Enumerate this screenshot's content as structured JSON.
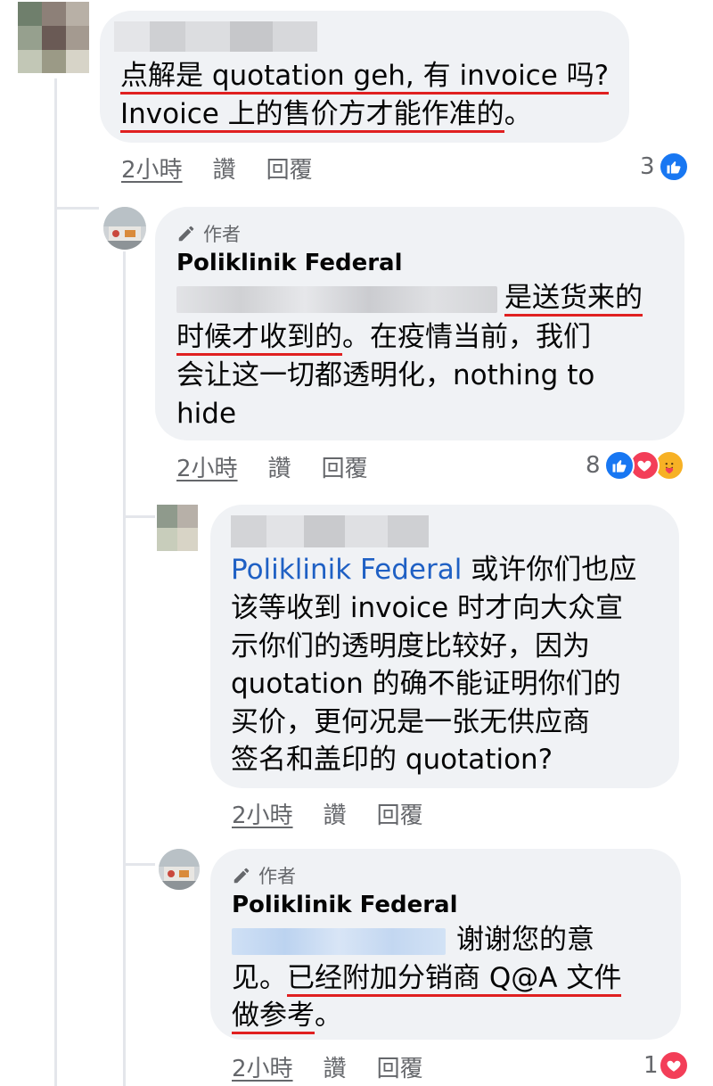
{
  "c1": {
    "text_l1a": "点解是 quotation geh, 有 invoice 吗?",
    "text_l2a": "Invoice 上的售价方才能作准的",
    "text_l2b": "。",
    "time": "2小時",
    "like": "讚",
    "reply": "回覆",
    "react_count": "3"
  },
  "c2": {
    "author_tag": "作者",
    "name": "Poliklinik Federal",
    "l1": "是送货来的",
    "l2a": "时候才收到的",
    "l2b": "。在疫情当前，我们",
    "l3": "会让这一切都透明化，nothing to",
    "l4": "hide",
    "time": "2小時",
    "like": "讚",
    "reply": "回覆",
    "react_count": "8"
  },
  "c3": {
    "mention": "Poliklinik Federal",
    "l1": " 或许你们也应",
    "l2": "该等收到 invoice 时才向大众宣",
    "l3": "示你们的透明度比较好，因为",
    "l4": "quotation 的确不能证明你们的",
    "l5": "买价，更何况是一张无供应商",
    "l6": "签名和盖印的 quotation?",
    "time": "2小時",
    "like": "讚",
    "reply": "回覆"
  },
  "c4": {
    "author_tag": "作者",
    "name": "Poliklinik Federal",
    "l1": "谢谢您的意",
    "l2a": "见。",
    "l2b": "已经附加分销商 Q@A 文件",
    "l3a": "做参考",
    "l3b": "。",
    "time": "2小時",
    "like": "讚",
    "reply": "回覆",
    "react_count": "1"
  },
  "colors": {
    "bubble": "#f0f2f5",
    "underline": "#e02020",
    "mention": "#1f60c4",
    "like": "#1877f2",
    "love": "#f33e58",
    "care": "#f7b125"
  },
  "icons": [
    "pencil-icon",
    "like-reaction-icon",
    "love-reaction-icon",
    "care-reaction-icon"
  ]
}
